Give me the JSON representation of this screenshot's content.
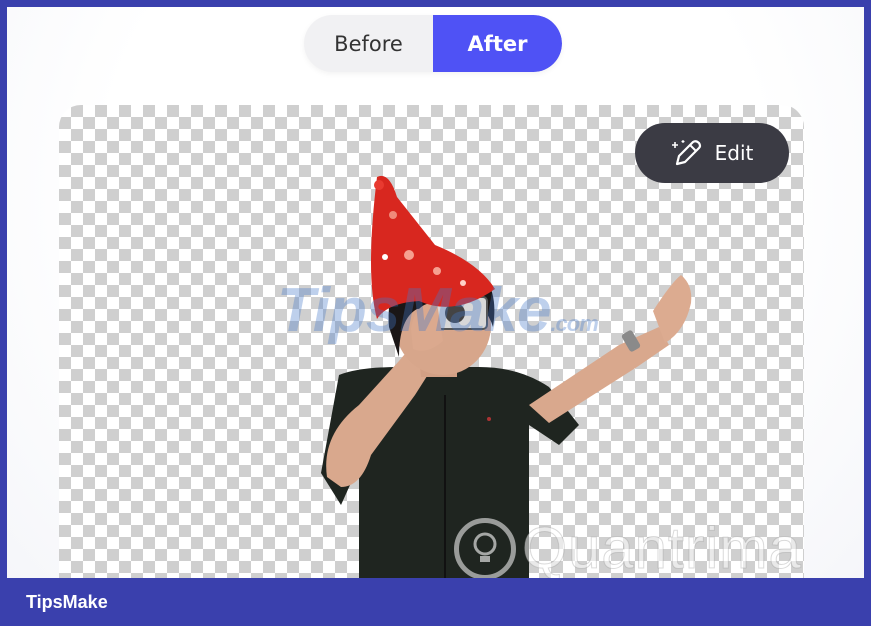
{
  "toggle": {
    "before_label": "Before",
    "after_label": "After",
    "selected": "After"
  },
  "preview": {
    "edit_label": "Edit",
    "edit_icon": "magic-pencil-icon",
    "background": "transparency-checkerboard"
  },
  "watermarks": {
    "tipsmake_main": "TipsMake",
    "tipsmake_suffix": ".com",
    "quantrimang": "Quantrimang"
  },
  "footer": {
    "label": "TipsMake"
  },
  "colors": {
    "accent": "#4f52f5",
    "frame": "#3a40ad",
    "edit_button_bg": "#3b3b44",
    "toggle_bg": "#f1f1f3"
  }
}
